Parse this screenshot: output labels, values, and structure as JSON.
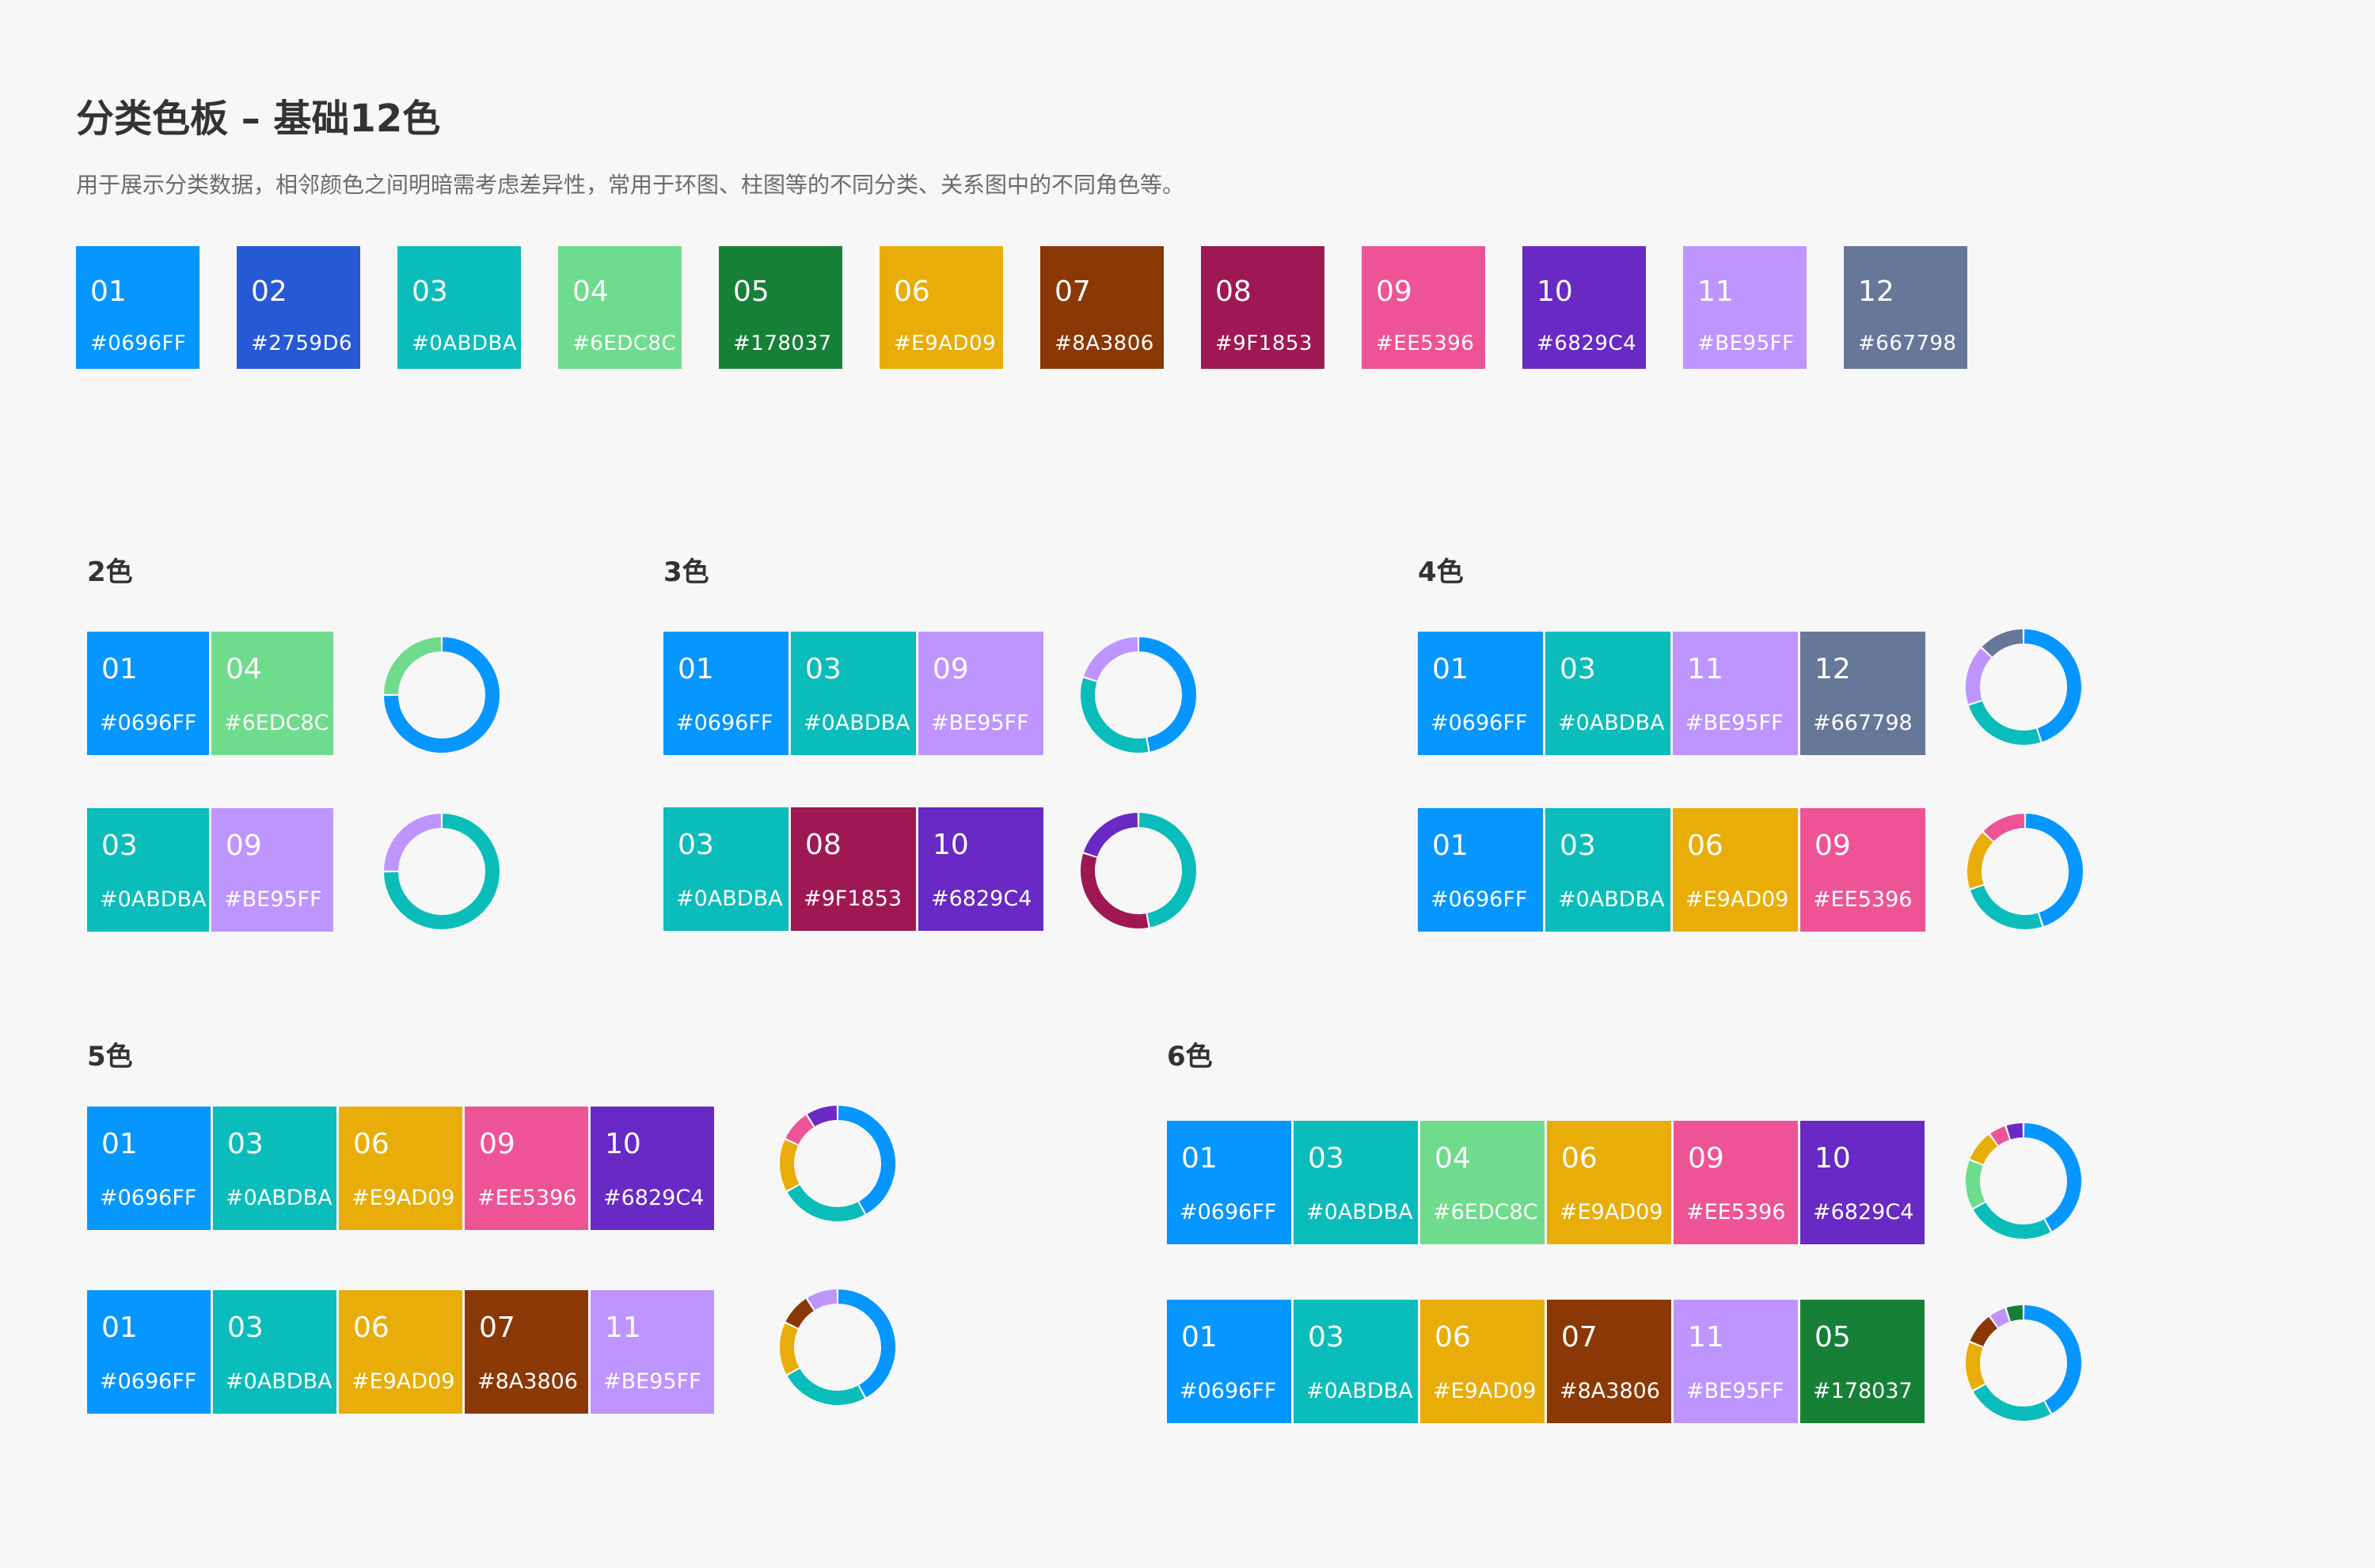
{
  "header": {
    "title": "分类色板 – 基础12色",
    "description": "用于展示分类数据，相邻颜色之间明暗需考虑差异性，常用于环图、柱图等的不同分类、关系图中的不同角色等。"
  },
  "base_palette": [
    {
      "num": "01",
      "hex": "#0696FF"
    },
    {
      "num": "02",
      "hex": "#2759D6"
    },
    {
      "num": "03",
      "hex": "#0ABDBA"
    },
    {
      "num": "04",
      "hex": "#6EDC8C"
    },
    {
      "num": "05",
      "hex": "#178037"
    },
    {
      "num": "06",
      "hex": "#E9AD09"
    },
    {
      "num": "07",
      "hex": "#8A3806"
    },
    {
      "num": "08",
      "hex": "#9F1853"
    },
    {
      "num": "09",
      "hex": "#EE5396"
    },
    {
      "num": "10",
      "hex": "#6829C4"
    },
    {
      "num": "11",
      "hex": "#BE95FF"
    },
    {
      "num": "12",
      "hex": "#667798"
    }
  ],
  "groups": [
    {
      "label": "2色",
      "rows": [
        [
          {
            "num": "01",
            "hex": "#0696FF"
          },
          {
            "num": "04",
            "hex": "#6EDC8C"
          }
        ],
        [
          {
            "num": "03",
            "hex": "#0ABDBA"
          },
          {
            "num": "09",
            "hex": "#BE95FF"
          }
        ]
      ]
    },
    {
      "label": "3色",
      "rows": [
        [
          {
            "num": "01",
            "hex": "#0696FF"
          },
          {
            "num": "03",
            "hex": "#0ABDBA"
          },
          {
            "num": "09",
            "hex": "#BE95FF"
          }
        ],
        [
          {
            "num": "03",
            "hex": "#0ABDBA"
          },
          {
            "num": "08",
            "hex": "#9F1853"
          },
          {
            "num": "10",
            "hex": "#6829C4"
          }
        ]
      ]
    },
    {
      "label": "4色",
      "rows": [
        [
          {
            "num": "01",
            "hex": "#0696FF"
          },
          {
            "num": "03",
            "hex": "#0ABDBA"
          },
          {
            "num": "11",
            "hex": "#BE95FF"
          },
          {
            "num": "12",
            "hex": "#667798"
          }
        ],
        [
          {
            "num": "01",
            "hex": "#0696FF"
          },
          {
            "num": "03",
            "hex": "#0ABDBA"
          },
          {
            "num": "06",
            "hex": "#E9AD09"
          },
          {
            "num": "09",
            "hex": "#EE5396"
          }
        ]
      ]
    },
    {
      "label": "5色",
      "rows": [
        [
          {
            "num": "01",
            "hex": "#0696FF"
          },
          {
            "num": "03",
            "hex": "#0ABDBA"
          },
          {
            "num": "06",
            "hex": "#E9AD09"
          },
          {
            "num": "09",
            "hex": "#EE5396"
          },
          {
            "num": "10",
            "hex": "#6829C4"
          }
        ],
        [
          {
            "num": "01",
            "hex": "#0696FF"
          },
          {
            "num": "03",
            "hex": "#0ABDBA"
          },
          {
            "num": "06",
            "hex": "#E9AD09"
          },
          {
            "num": "07",
            "hex": "#8A3806"
          },
          {
            "num": "11",
            "hex": "#BE95FF"
          }
        ]
      ]
    },
    {
      "label": "6色",
      "rows": [
        [
          {
            "num": "01",
            "hex": "#0696FF"
          },
          {
            "num": "03",
            "hex": "#0ABDBA"
          },
          {
            "num": "04",
            "hex": "#6EDC8C"
          },
          {
            "num": "06",
            "hex": "#E9AD09"
          },
          {
            "num": "09",
            "hex": "#EE5396"
          },
          {
            "num": "10",
            "hex": "#6829C4"
          }
        ],
        [
          {
            "num": "01",
            "hex": "#0696FF"
          },
          {
            "num": "03",
            "hex": "#0ABDBA"
          },
          {
            "num": "06",
            "hex": "#E9AD09"
          },
          {
            "num": "07",
            "hex": "#8A3806"
          },
          {
            "num": "11",
            "hex": "#BE95FF"
          },
          {
            "num": "05",
            "hex": "#178037"
          }
        ]
      ]
    }
  ],
  "donut_fractions": {
    "2": [
      [
        0.75,
        0.25
      ],
      [
        0.75,
        0.25
      ]
    ],
    "3": [
      [
        0.47,
        0.33,
        0.2
      ],
      [
        0.47,
        0.33,
        0.2
      ]
    ],
    "4": [
      [
        0.45,
        0.25,
        0.17,
        0.13
      ],
      [
        0.45,
        0.25,
        0.17,
        0.13
      ]
    ],
    "5": [
      [
        0.42,
        0.25,
        0.15,
        0.09,
        0.09
      ],
      [
        0.42,
        0.25,
        0.15,
        0.09,
        0.09
      ]
    ],
    "6": [
      [
        0.42,
        0.25,
        0.14,
        0.09,
        0.05,
        0.05
      ],
      [
        0.42,
        0.25,
        0.14,
        0.09,
        0.05,
        0.05
      ]
    ]
  }
}
